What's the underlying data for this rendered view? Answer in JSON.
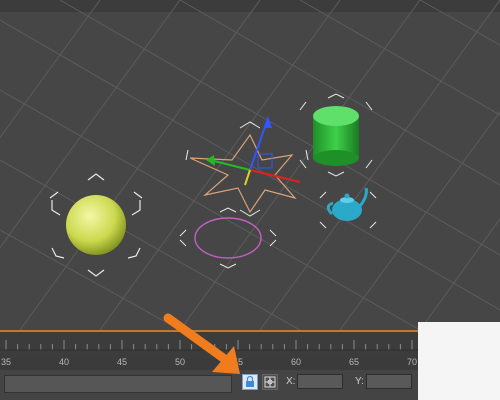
{
  "viewport": {
    "objects": [
      "sphere",
      "star-shape",
      "ellipse-shape",
      "cylinder",
      "teapot"
    ],
    "colors": {
      "grid": "#5e5e5e",
      "sphere": "#d6e35e",
      "star": "#d9a27a",
      "ellipse": "#c060c0",
      "cylinder": "#2fbf3a",
      "teapot": "#2aa9c9"
    }
  },
  "timeline": {
    "ticks": [
      "35",
      "40",
      "45",
      "50",
      "55",
      "60",
      "65",
      "70"
    ]
  },
  "statusbar": {
    "x_label": "X:",
    "y_label": "Y:",
    "x_value": "",
    "y_value": ""
  },
  "annotation": {
    "arrow_color": "#f07c1e"
  }
}
